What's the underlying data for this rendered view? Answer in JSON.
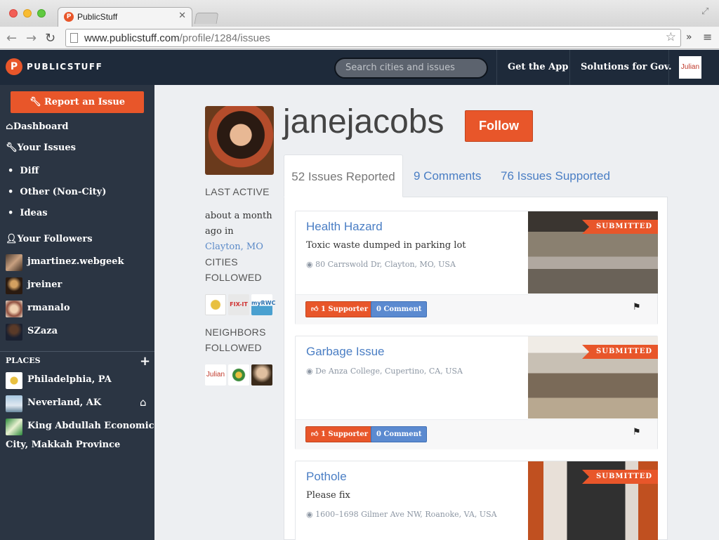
{
  "browser": {
    "tab_title": "PublicStuff",
    "url_host": "www.publicstuff.com",
    "url_path": "/profile/1284/issues"
  },
  "header": {
    "brand": "PUBLICSTUFF",
    "search_placeholder": "Search cities and issues",
    "get_app": "Get the App",
    "solutions": "Solutions for Gov.",
    "user_badge": "Julian"
  },
  "sidebar": {
    "report_button": "Report an Issue",
    "dashboard": "Dashboard",
    "your_issues": "Your Issues",
    "issue_categories": [
      "Diff",
      "Other (Non-City)",
      "Ideas"
    ],
    "your_followers": "Your Followers",
    "followers": [
      "jmartinez.webgeek",
      "jreiner",
      "rmanalo",
      "SZaza"
    ],
    "places_heading": "PLACES",
    "places": [
      "Philadelphia, PA",
      "Neverland, AK",
      "King Abdullah Economic",
      "City, Makkah Province"
    ]
  },
  "profile": {
    "username": "janejacobs",
    "follow_label": "Follow",
    "last_active_heading": "LAST ACTIVE",
    "last_active_line1": "about a month",
    "last_active_line2": "ago in",
    "last_active_city": "Clayton, MO",
    "cities_followed_line1": "CITIES",
    "cities_followed_line2": "FOLLOWED",
    "neighbors_followed_line1": "NEIGHBORS",
    "neighbors_followed_line2": "FOLLOWED",
    "city_badges": [
      "FIX-IT",
      "myRWC"
    ],
    "neighbor_badge": "Julian"
  },
  "tabs": {
    "issues_reported": "52 Issues Reported",
    "comments": "9 Comments",
    "issues_supported": "76 Issues Supported"
  },
  "issues": [
    {
      "title": "Health Hazard",
      "description": "Toxic waste dumped in parking lot",
      "address": "80 Carrswold Dr, Clayton, MO, USA",
      "status": "SUBMITTED",
      "supporters": "1 Supporter",
      "comments": "0 Comment"
    },
    {
      "title": "Garbage Issue",
      "description": "",
      "address": "De Anza College, Cupertino, CA, USA",
      "status": "SUBMITTED",
      "supporters": "1 Supporter",
      "comments": "0 Comment"
    },
    {
      "title": "Pothole",
      "description": "Please fix",
      "address": "1600–1698 Gilmer Ave NW, Roanoke, VA, USA",
      "status": "SUBMITTED"
    }
  ],
  "colors": {
    "accent": "#e8562a",
    "link": "#4a7ec4",
    "sidebar": "#2b3543",
    "header": "#1e2a3a"
  }
}
